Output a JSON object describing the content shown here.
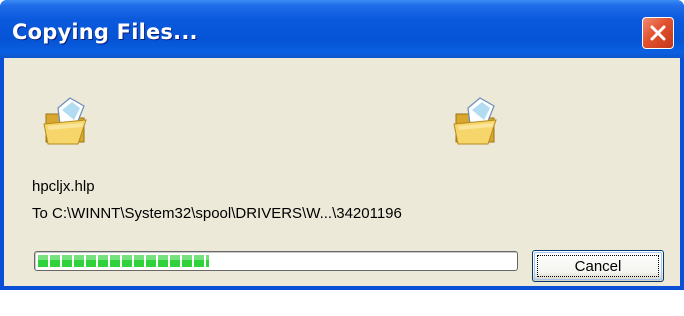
{
  "window": {
    "title": "Copying Files..."
  },
  "icons": {
    "source": "open-folder-icon",
    "destination": "open-folder-icon",
    "close": "close-icon"
  },
  "file": {
    "name": "hpcljx.hlp",
    "destination": "To C:\\WINNT\\System32\\spool\\DRIVERS\\W...\\34201196"
  },
  "progress": {
    "fraction": 0.36
  },
  "buttons": {
    "cancel_label": "Cancel"
  },
  "colors": {
    "title_bar": "#0a58dc",
    "close_button": "#e2522e",
    "dialog_face": "#ece9d8",
    "progress_fill": "#2fd23a"
  }
}
